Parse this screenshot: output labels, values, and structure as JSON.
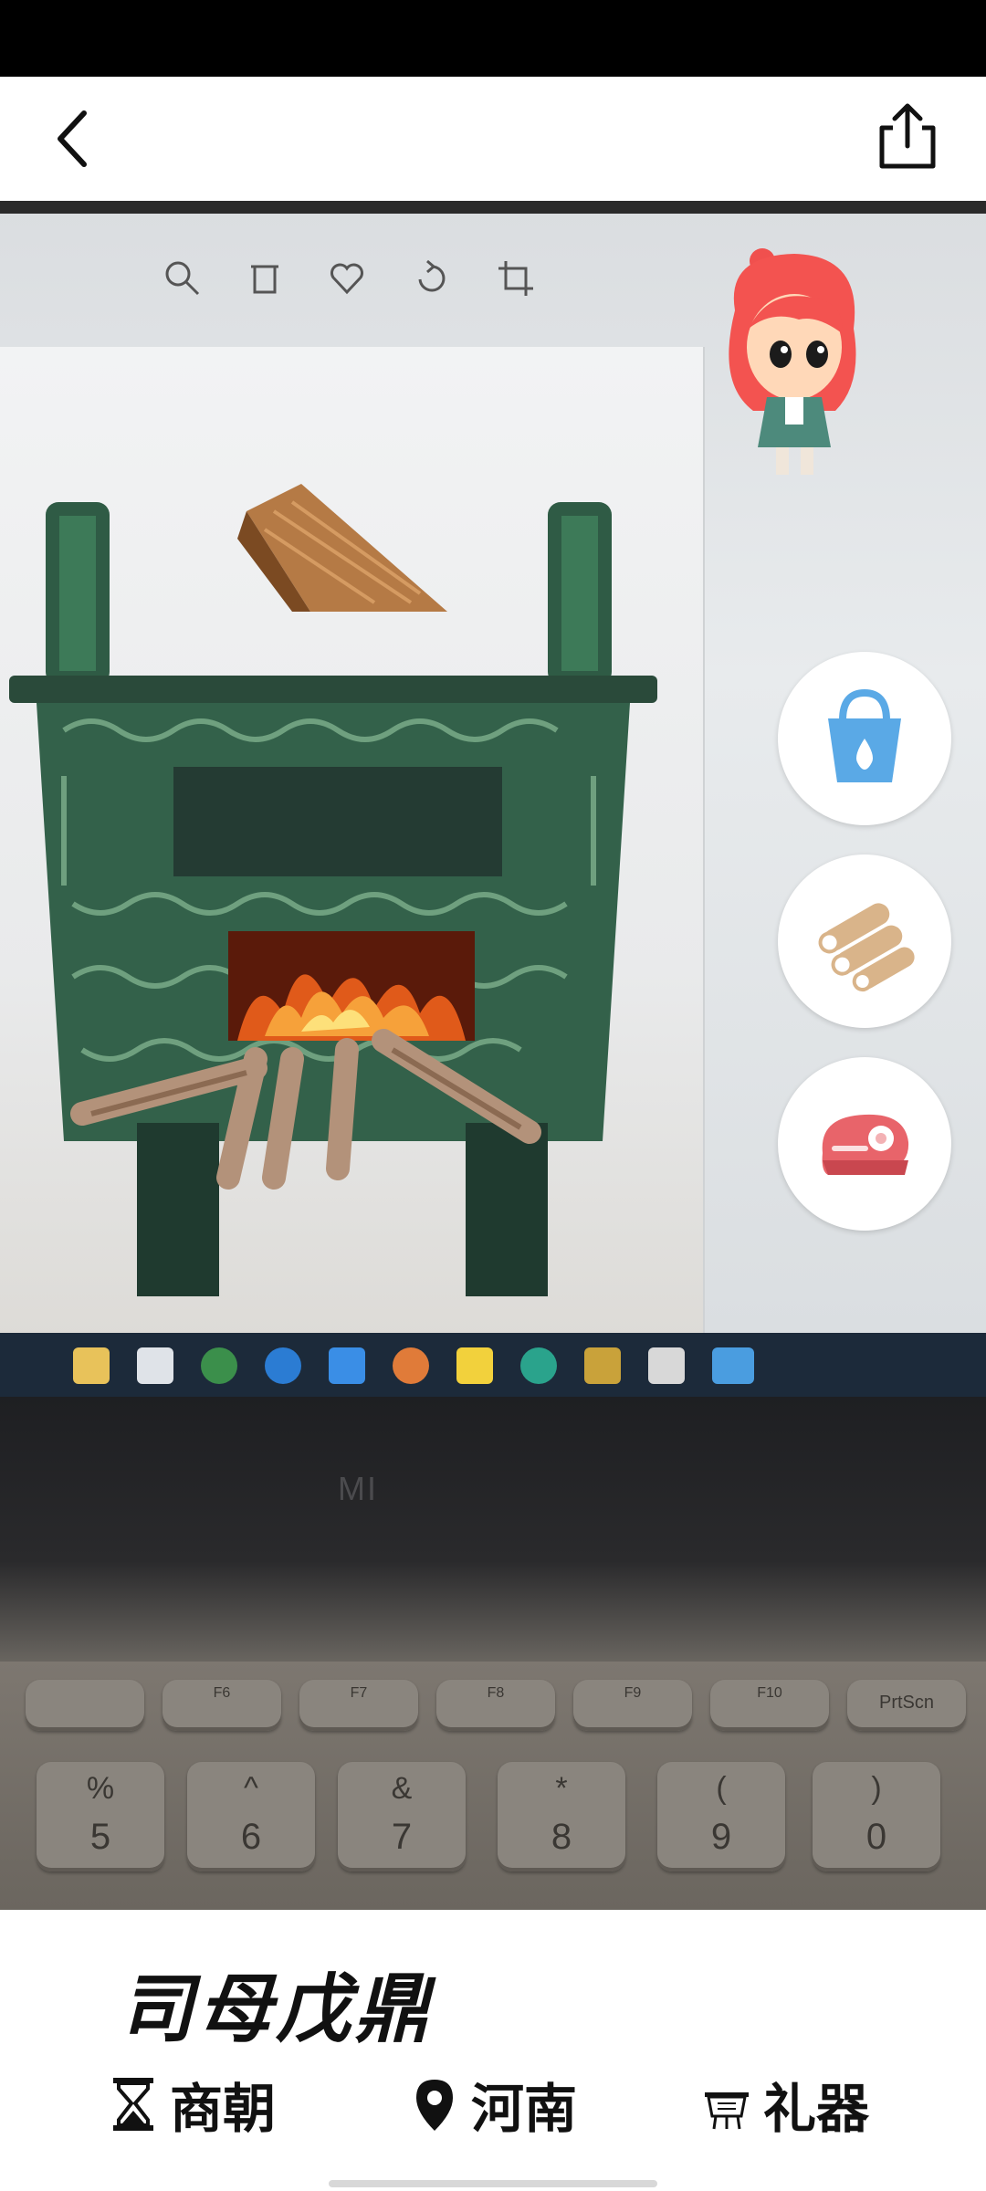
{
  "header": {
    "back_icon": "chevron-left-icon",
    "share_icon": "share-icon"
  },
  "ar_scene": {
    "laptop_brand": "MI",
    "keyboard": {
      "function_keys": [
        "F6",
        "F7",
        "F8",
        "F9",
        "F10",
        "PrtScn"
      ],
      "number_keys": [
        {
          "top": "%",
          "bottom": "5"
        },
        {
          "top": "^",
          "bottom": "6"
        },
        {
          "top": "&",
          "bottom": "7"
        },
        {
          "top": "*",
          "bottom": "8"
        },
        {
          "top": "(",
          "bottom": "9"
        },
        {
          "top": ")",
          "bottom": "0"
        }
      ]
    }
  },
  "actions": [
    {
      "name": "water-bucket",
      "icon": "water-bucket-icon",
      "color": "#5aa9e6"
    },
    {
      "name": "firewood",
      "icon": "firewood-icon",
      "color": "#d9b48a"
    },
    {
      "name": "meat",
      "icon": "meat-icon",
      "color": "#e8646a"
    }
  ],
  "relic": {
    "title": "司母戊鼎",
    "dynasty": "商朝",
    "province": "河南",
    "category": "礼器"
  }
}
